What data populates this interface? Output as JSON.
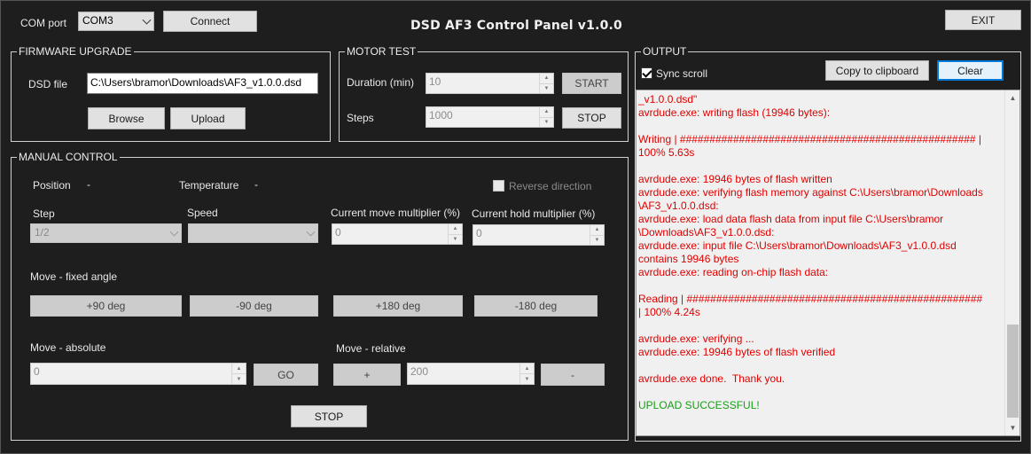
{
  "header": {
    "com_port_label": "COM port",
    "com_port_value": "COM3",
    "connect_label": "Connect",
    "title": "DSD AF3 Control Panel v1.0.0",
    "exit_label": "EXIT"
  },
  "firmware": {
    "group_title": "FIRMWARE UPGRADE",
    "dsd_file_label": "DSD file",
    "dsd_file_value": "C:\\Users\\bramor\\Downloads\\AF3_v1.0.0.dsd",
    "browse_label": "Browse",
    "upload_label": "Upload"
  },
  "motor_test": {
    "group_title": "MOTOR TEST",
    "duration_label": "Duration (min)",
    "duration_value": "10",
    "steps_label": "Steps",
    "steps_value": "1000",
    "start_label": "START",
    "stop_label": "STOP"
  },
  "manual": {
    "group_title": "MANUAL CONTROL",
    "position_label": "Position",
    "position_value": "-",
    "temperature_label": "Temperature",
    "temperature_value": "-",
    "reverse_label": "Reverse direction",
    "step_label": "Step",
    "step_value": "1/2",
    "speed_label": "Speed",
    "speed_value": "",
    "current_move_label": "Current move multiplier (%)",
    "current_move_value": "0",
    "current_hold_label": "Current hold multiplier (%)",
    "current_hold_value": "0",
    "fixed_angle_label": "Move - fixed angle",
    "fixed_buttons": [
      "+90 deg",
      "-90  deg",
      "+180  deg",
      "-180 deg"
    ],
    "absolute_label": "Move - absolute",
    "absolute_value": "0",
    "go_label": "GO",
    "relative_label": "Move - relative",
    "plus_label": "+",
    "relative_value": "200",
    "minus_label": "-",
    "stop_label": "STOP"
  },
  "output": {
    "group_title": "OUTPUT",
    "sync_scroll_label": "Sync scroll",
    "sync_scroll_checked": true,
    "copy_label": "Copy to clipboard",
    "clear_label": "Clear",
    "lines": [
      {
        "text": "_v1.0.0.dsd\"",
        "color": "red"
      },
      {
        "text": "avrdude.exe: writing flash (19946 bytes):",
        "color": "red"
      },
      {
        "text": "",
        "color": "red"
      },
      {
        "text": "Writing | ################################################## |",
        "color": "red"
      },
      {
        "text": "100% 5.63s",
        "color": "red"
      },
      {
        "text": "",
        "color": "red"
      },
      {
        "text": "avrdude.exe: 19946 bytes of flash written",
        "color": "red"
      },
      {
        "text": "avrdude.exe: verifying flash memory against C:\\Users\\bramor\\Downloads",
        "color": "red"
      },
      {
        "text": "\\AF3_v1.0.0.dsd:",
        "color": "red"
      },
      {
        "text": "avrdude.exe: load data flash data from input file C:\\Users\\bramor",
        "color": "red"
      },
      {
        "text": "\\Downloads\\AF3_v1.0.0.dsd:",
        "color": "red"
      },
      {
        "text": "avrdude.exe: input file C:\\Users\\bramor\\Downloads\\AF3_v1.0.0.dsd",
        "color": "red"
      },
      {
        "text": "contains 19946 bytes",
        "color": "red"
      },
      {
        "text": "avrdude.exe: reading on-chip flash data:",
        "color": "red"
      },
      {
        "text": "",
        "color": "red"
      },
      {
        "text": "Reading | ################################################## ",
        "color": "red"
      },
      {
        "text": "| 100% 4.24s",
        "color": "red"
      },
      {
        "text": "",
        "color": "red"
      },
      {
        "text": "avrdude.exe: verifying ...",
        "color": "red"
      },
      {
        "text": "avrdude.exe: 19946 bytes of flash verified",
        "color": "red"
      },
      {
        "text": "",
        "color": "red"
      },
      {
        "text": "avrdude.exe done.  Thank you.",
        "color": "red"
      },
      {
        "text": "",
        "color": "red"
      },
      {
        "text": "UPLOAD SUCCESSFUL!",
        "color": "green"
      }
    ]
  },
  "colors": {
    "background": "#1e1e1e",
    "log_error": "#e00000",
    "log_success": "#16a016"
  }
}
